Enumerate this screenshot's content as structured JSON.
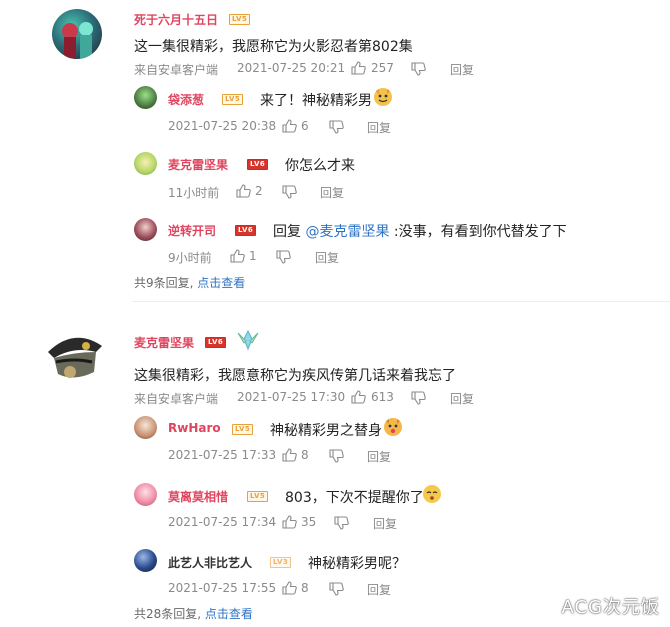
{
  "threads": [
    {
      "user": "死于六月十五日",
      "name_color": "#e0455f",
      "level": "LV5",
      "content": "这一集很精彩，我愿称它为火影忍者第802集",
      "source": "来自安卓客户端",
      "time": "2021-07-25 20:21",
      "likes": "257",
      "reply_label": "回复",
      "replies": [
        {
          "user": "袋添葱",
          "name_color": "#e0455f",
          "level": "LV5",
          "content": "来了！神秘精彩男",
          "time": "2021-07-25 20:38",
          "likes": "6",
          "reply_label": "回复"
        },
        {
          "user": "麦克雷坚果",
          "name_color": "#e0455f",
          "level": "LV6",
          "content": "你怎么才来",
          "time": "11小时前",
          "likes": "2",
          "reply_label": "回复"
        },
        {
          "user": "逆转开司",
          "name_color": "#e0455f",
          "level": "LV6",
          "content_prefix": "回复",
          "mention": "@麦克雷坚果",
          "content_suffix": ":没事，有看到你代替发了下",
          "time": "9小时前",
          "likes": "1",
          "reply_label": "回复"
        }
      ],
      "more_text": "共9条回复,",
      "more_link": "点击查看"
    },
    {
      "user": "麦克雷坚果",
      "name_color": "#e0455f",
      "level": "LV6",
      "content": "这集很精彩，我愿意称它为疾风传第几话来着我忘了",
      "source": "来自安卓客户端",
      "time": "2021-07-25 17:30",
      "likes": "613",
      "reply_label": "回复",
      "replies": [
        {
          "user": "RwHaro",
          "name_color": "#e0455f",
          "level": "LV5",
          "content": "神秘精彩男之替身",
          "time": "2021-07-25 17:33",
          "likes": "8",
          "reply_label": "回复"
        },
        {
          "user": "莫离莫相惜",
          "name_color": "#e0455f",
          "level": "LV5",
          "content": "803，下次不提醒你了",
          "time": "2021-07-25 17:34",
          "likes": "35",
          "reply_label": "回复"
        },
        {
          "user": "此艺人非比艺人",
          "name_color": "#333333",
          "level": "LV3",
          "content": "神秘精彩男呢？",
          "time": "2021-07-25 17:55",
          "likes": "8",
          "reply_label": "回复"
        }
      ],
      "more_text": "共28条回复,",
      "more_link": "点击查看"
    }
  ],
  "watermark": "ACG次元饭",
  "colors": {
    "link": "#2f74c4",
    "meta": "#8a8a8a",
    "level5": "#e8a23a",
    "level6": "#d9342b"
  }
}
